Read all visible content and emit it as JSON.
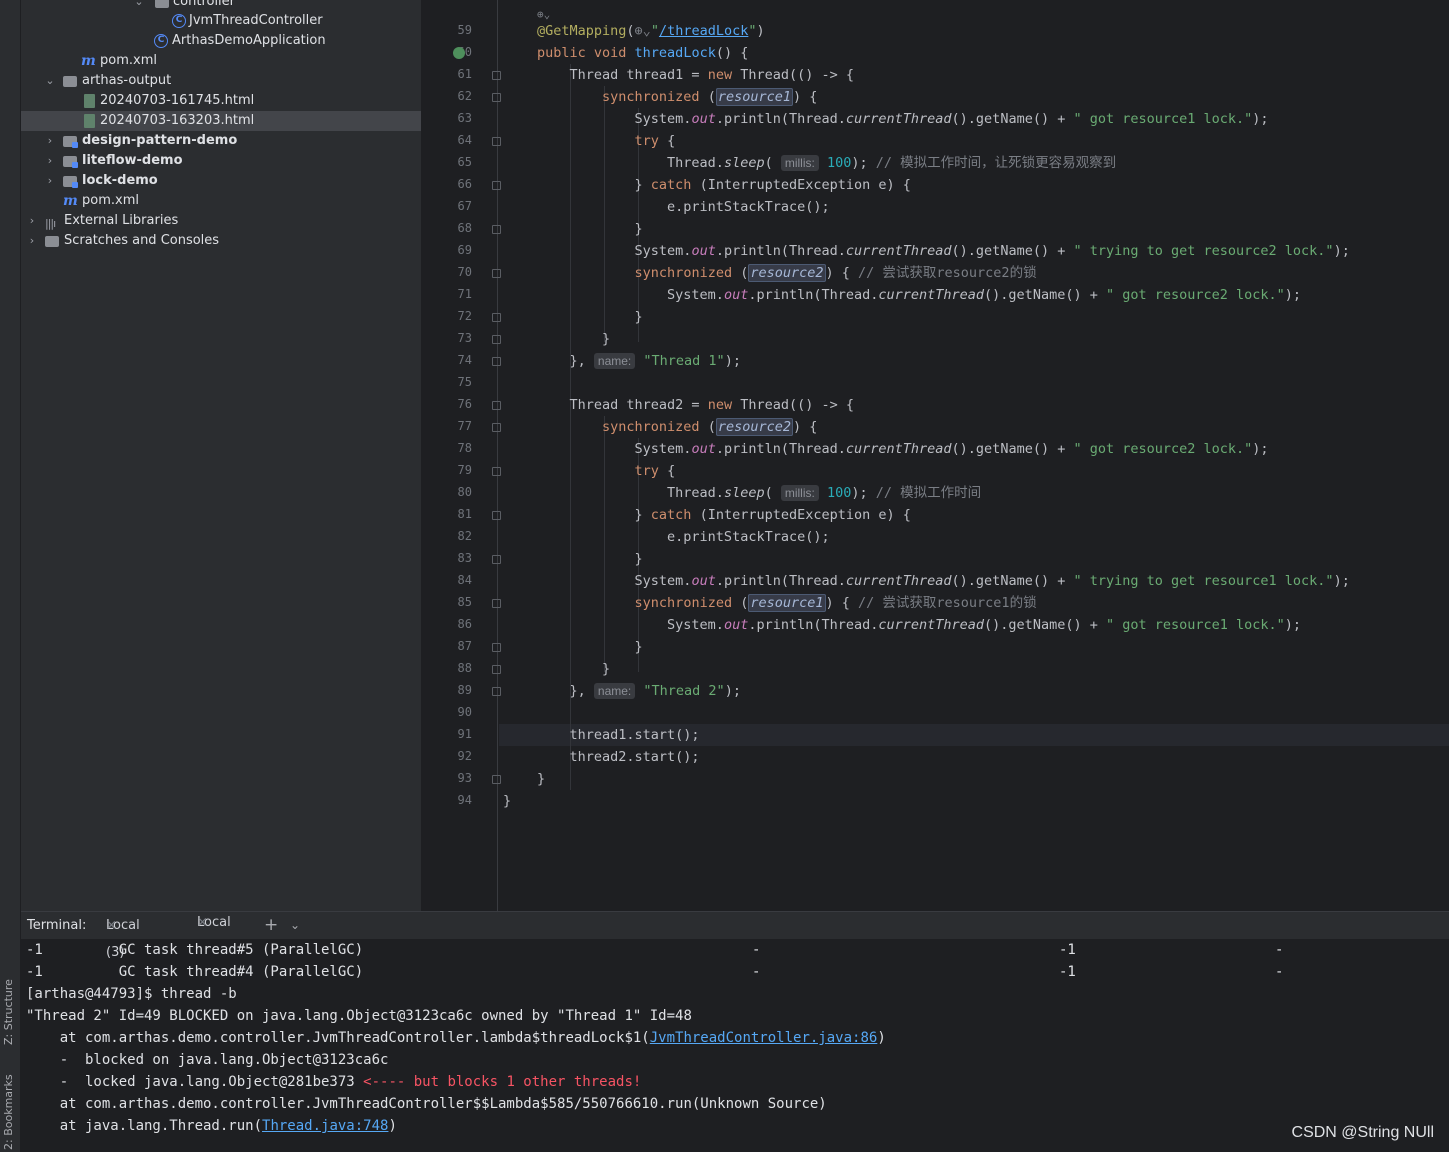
{
  "side_tabs": {
    "structure": "Z: Structure",
    "bookmarks": "2: Bookmarks"
  },
  "project_tree": [
    {
      "label": "controller",
      "arrow": "⌄",
      "icon": "folder-icon"
    },
    {
      "label": "JvmThreadController",
      "arrow": "",
      "icon": "class-icon"
    },
    {
      "label": "ArthasDemoApplication",
      "arrow": "",
      "icon": "spring-class-icon"
    },
    {
      "label": "pom.xml",
      "arrow": "",
      "icon": "maven-icon"
    },
    {
      "label": "arthas-output",
      "arrow": "⌄",
      "icon": "folder-icon"
    },
    {
      "label": "20240703-161745.html",
      "arrow": "",
      "icon": "html-file-icon"
    },
    {
      "label": "20240703-163203.html",
      "arrow": "",
      "icon": "html-file-icon"
    },
    {
      "label": "design-pattern-demo",
      "arrow": "›",
      "icon": "module-folder-icon"
    },
    {
      "label": "liteflow-demo",
      "arrow": "›",
      "icon": "module-folder-icon"
    },
    {
      "label": "lock-demo",
      "arrow": "›",
      "icon": "module-folder-icon"
    },
    {
      "label": "pom.xml",
      "arrow": "",
      "icon": "maven-icon"
    },
    {
      "label": "External Libraries",
      "arrow": "›",
      "icon": "library-icon"
    },
    {
      "label": "Scratches and Consoles",
      "arrow": "›",
      "icon": "scratches-icon"
    }
  ],
  "editor": {
    "line_numbers": [
      "59",
      "60",
      "61",
      "62",
      "63",
      "64",
      "65",
      "66",
      "67",
      "68",
      "69",
      "70",
      "71",
      "72",
      "73",
      "74",
      "75",
      "76",
      "77",
      "78",
      "79",
      "80",
      "81",
      "82",
      "83",
      "84",
      "85",
      "86",
      "87",
      "88",
      "89",
      "90",
      "91",
      "92",
      "93",
      "94"
    ],
    "code": {
      "mapping_path": "/threadLock",
      "method_name": "threadLock",
      "comment_65": "// 模拟工作时间，让死锁更容易观察到",
      "comment_70": "// 尝试获取resource2的锁",
      "comment_80": "// 模拟工作时间",
      "comment_85": "// 尝试获取resource1的锁",
      "str_got_r1": "\" got resource1 lock.\"",
      "str_try_r2": "\" trying to get resource2 lock.\"",
      "str_got_r2": "\" got resource2 lock.\"",
      "str_try_r1": "\" trying to get resource1 lock.\"",
      "thread1_name": "\"Thread 1\"",
      "thread2_name": "\"Thread 2\"",
      "hint_millis": "millis:",
      "hint_name": "name:",
      "sleep_ms": "100"
    }
  },
  "terminal": {
    "title": "Terminal:",
    "tabs": [
      "Local (3)",
      "Local"
    ],
    "active_tab": "Local",
    "lines": {
      "gc5": "-1         GC task thread#5 (ParallelGC)",
      "gc5_c2": "-",
      "gc5_c3": "-1",
      "gc5_c4": "-",
      "gc4": "-1         GC task thread#4 (ParallelGC)",
      "gc4_c2": "-",
      "gc4_c3": "-1",
      "gc4_c4": "-",
      "prompt": "[arthas@44793]$ thread -b",
      "blocked": "\"Thread 2\" Id=49 BLOCKED on java.lang.Object@3123ca6c owned by \"Thread 1\" Id=48",
      "at1_pre": "    at com.arthas.demo.controller.JvmThreadController.lambda$threadLock$1(",
      "at1_link": "JvmThreadController.java:86",
      "at1_post": ")",
      "blocked_on": "    -  blocked on java.lang.Object@3123ca6c",
      "locked_pre": "    -  locked java.lang.Object@281be373 ",
      "locked_warn": "<---- but blocks 1 other threads!",
      "at2": "    at com.arthas.demo.controller.JvmThreadController$$Lambda$585/550766610.run(Unknown Source)",
      "at3_pre": "    at java.lang.Thread.run(",
      "at3_link": "Thread.java:748",
      "at3_post": ")"
    }
  },
  "watermark": "CSDN @String NUll"
}
